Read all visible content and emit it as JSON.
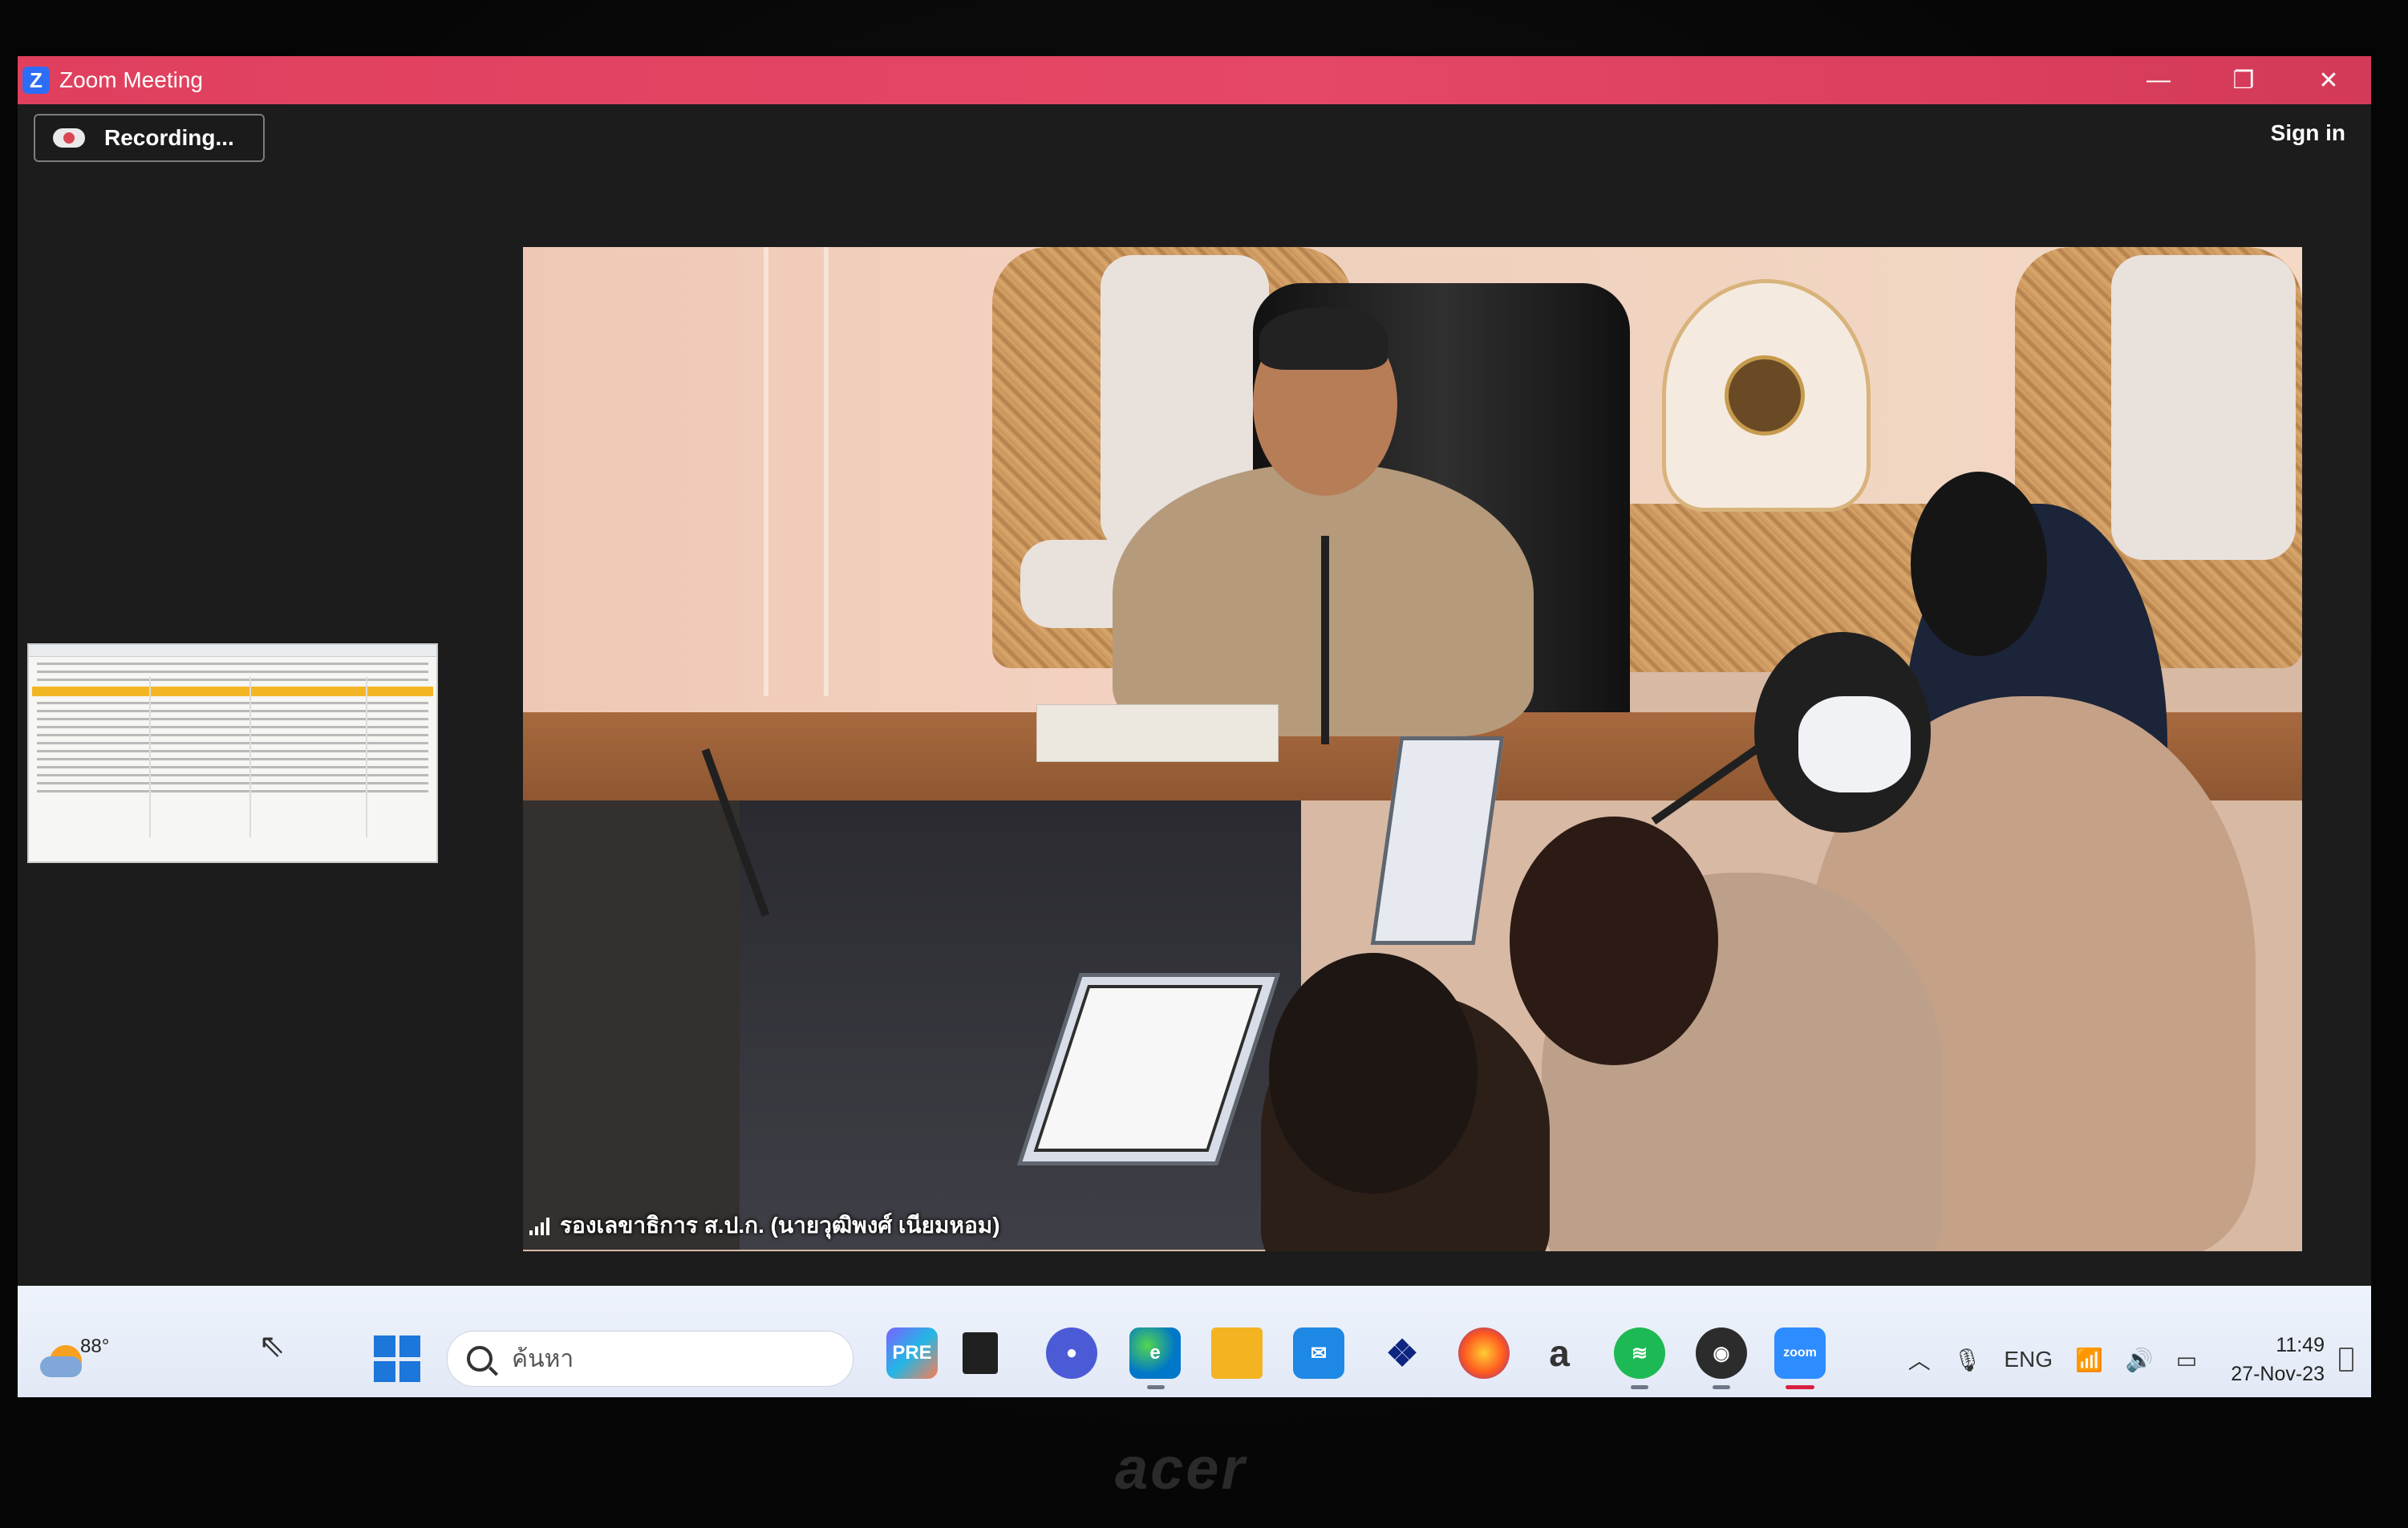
{
  "window": {
    "title": "Zoom Meeting",
    "app_icon": "zoom-logo-icon"
  },
  "window_controls": [
    "minimize",
    "restore",
    "close"
  ],
  "toolbar": {
    "recording_label": "Recording...",
    "sign_in_label": "Sign in"
  },
  "video": {
    "participant_name": "รองเลขาธิการ ส.ป.ก. (นายวุฒิพงศ์ เนียมหอม)"
  },
  "taskbar": {
    "weather_temp": "88°",
    "search_placeholder": "ค้นหา",
    "apps": [
      "copilot",
      "file-manager",
      "chat",
      "edge",
      "file-explorer",
      "mail",
      "dropbox",
      "firefox",
      "amazon",
      "spotify",
      "obs",
      "zoom"
    ],
    "language": "ENG",
    "time": "11:49",
    "date": "27-Nov-23"
  },
  "monitor": {
    "brand": "acer"
  },
  "colors": {
    "titlebar": "#e54766",
    "accent": "#1d76da",
    "zoom_blue": "#2d6df6"
  }
}
